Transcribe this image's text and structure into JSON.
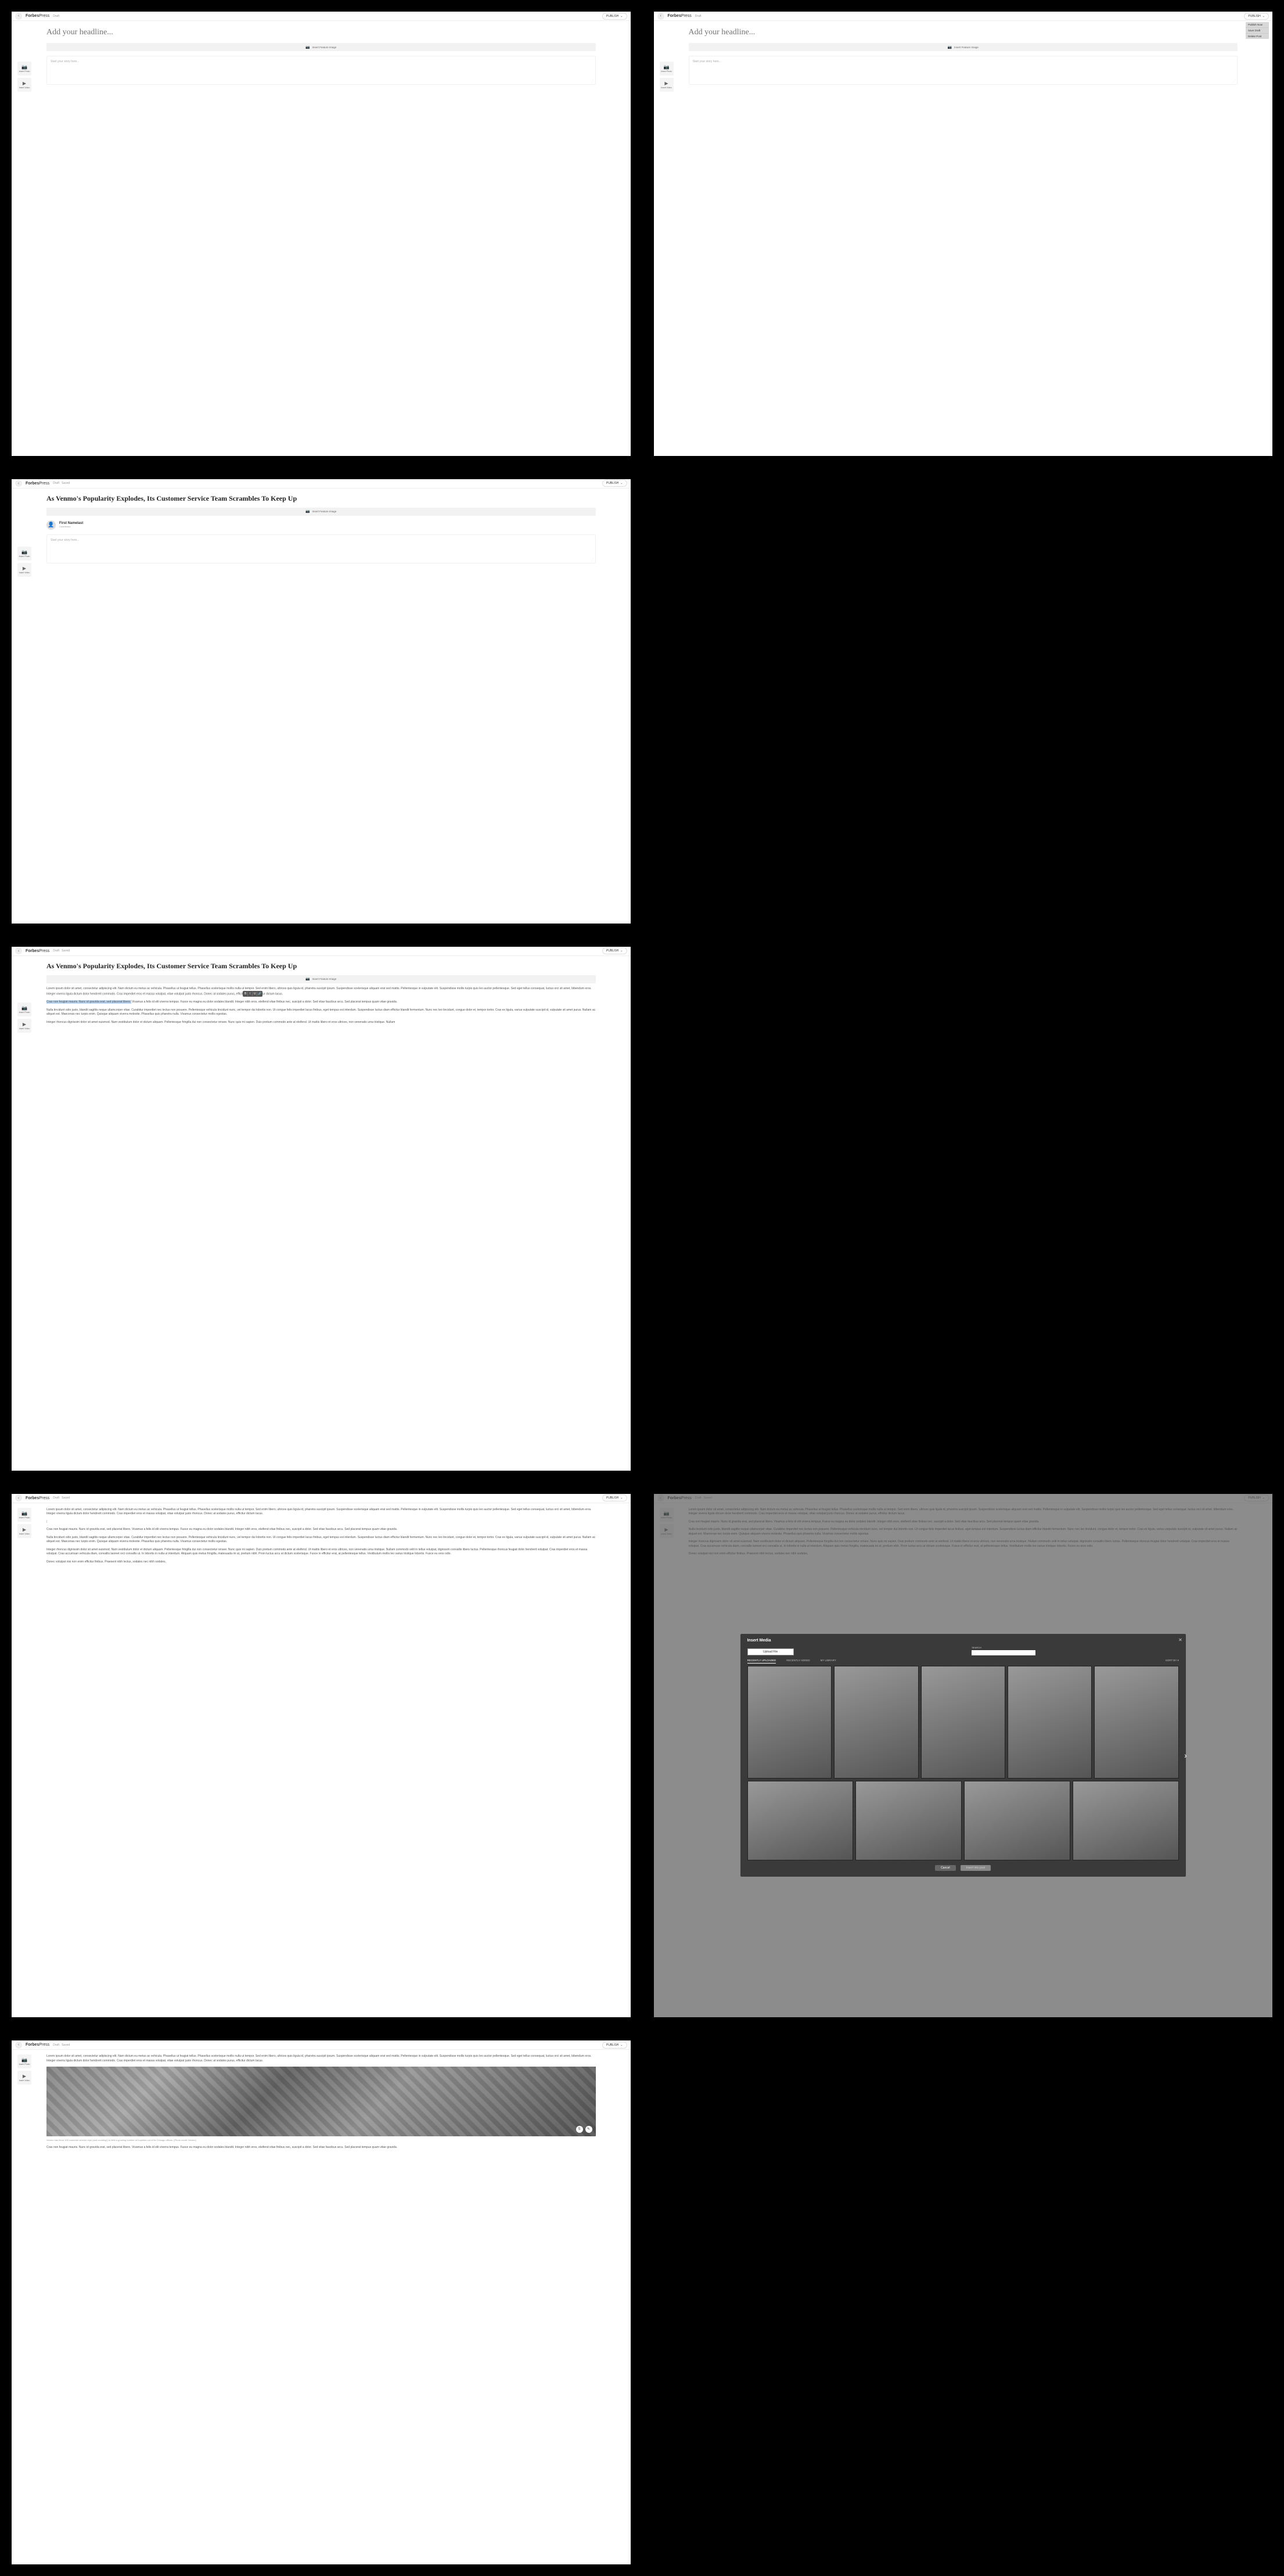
{
  "brand": {
    "bold": "Forbes",
    "thin": "Press"
  },
  "topbar": {
    "draft_label": "Draft",
    "saved_label": "Saved",
    "publish_label": "PUBLISH"
  },
  "dropdown": {
    "publish_now": "Publish Now",
    "save_draft": "Save Draft",
    "delete_post": "Delete Post"
  },
  "editor": {
    "headline_placeholder": "Add your headline...",
    "feature_image_label": "Insert Feature Image",
    "story_placeholder": "Start your story here...",
    "headline_filled": "As Venmo's Popularity Explodes, Its Customer Service Team Scrambles To Keep Up"
  },
  "sidebar": {
    "insert_photo": "Insert Photo",
    "insert_video": "Insert Video"
  },
  "author": {
    "name": "First Namelast",
    "role": "Contributor"
  },
  "inline_tools": {
    "bold": "B",
    "italic": "I",
    "underline": "U",
    "link": "🔗"
  },
  "body": {
    "p1": "Lorem ipsum dolor sit amet, consectetur adipiscing elit. Nam dictum eu metus ac vehicula. Phasellus ut feugiat tellus. Phasellus scelerisque mollis nulla ut tempor. Sed enim libero, ultrices quis ligula id, pharetra suscipit ipsum. Suspendisse scelerisque aliquam erat sed mattis. Pellentesque in vulputate elit. Suspendisse mollis turpis quis leo auctor pellentesque. Sed eget tellus consequat, luctus orci sit amet, bibendum eros. Integer viverra ligula dictum dolor hendrerit commodo. Cras imperdiet eros et massa volutpat, vitae volutpat justo rhoncus. Donec at sodales purus, efficit",
    "p1_tail": "ur dictum lacus.",
    "p2_hl": "Cras non feugiat mauris. Nunc id gravida erat, sed placerat libero.",
    "p2_rest": " Vivamus a felis id elit viverra tempus. Fusce eu magna eu dolor sodales blandit. Integer nibh eros, eleifend vitae finibus nec, suscipit a dolor. Sed vitae faucibus arcu. Sed placerat tempus quam vitae gravida.",
    "p3": "Nulla tincidunt odio justo, blandit sagittis neque ullamcorper vitae. Curabitur imperdiet nec lectus non posuere. Pellentesque vehicula tincidunt nunc, vel tempor dui lobortis non. Ut congue felis imperdiet lacus finibus, eget tempus est interdum. Suspendisse luctus diam efficitur blandit fermentum. Nunc nec leo tincidunt, congue dolor et, tempor tortor. Cras ex ligula, varius vulputate suscipit id, vulputate sit amet purus. Nullam ac aliquet est. Maecenas nec turpis enim. Quisque aliquam viverra molestie. Phasellus quis pharetra nulla. Vivamus consectetur mollis egestas.",
    "p4": "Integer rhoncus dignissim dolor sit amet euismod. Nam vestibulum dolor et dictum aliquam. Pellentesque fringilla dui non consectetur ornare. Nunc quis mi sapien. Duis pretium commodo ante at eleifend. Ut mattis libero et eros ultrices, non venenatis urna tristique. Nullam commodo velit in tellus volutpat, dignissim convallis libero luctus. Pellentesque rhoncus feugiat dolor hendrerit volutpat. Cras imperdiet eros et massa volutpat. Cras accumsan vehicula diam, convallis laoreet orci convallis ut. In lobortis in nulla ut interdum. Aliquam quis metus fringilla, malesuada mi at, pretium nibh. Proin luctus arcu at dictum scelerisque. Fusce in efficitur erat, at pellentesque tellus. Vestibulum mollis leo varius tristique lobortis. Fusce eu eros odio.",
    "p5": "Donec volutpat nisi non enim efficitur finibus. Praesent nibh lectus, sodales nec nibh sodales,",
    "p1_plain": "Lorem ipsum dolor sit amet, consectetur adipiscing elit. Nam dictum eu metus ac vehicula. Phasellus ut feugiat tellus. Phasellus scelerisque mollis nulla ut tempor. Sed enim libero, ultrices quis ligula id, pharetra suscipit ipsum. Suspendisse scelerisque aliquam erat sed mattis. Pellentesque in vulputate elit. Suspendisse mollis turpis quis leo auctor pellentesque. Sed eget tellus consequat, luctus orci sit amet, bibendum eros. Integer viverra ligula dictum dolor hendrerit commodo. Cras imperdiet eros et massa volutpat, vitae volutpat justo rhoncus. Donec at sodales purus, efficitur dictum lacus.",
    "p2_plain": "Cras non feugiat mauris. Nunc id gravida erat, sed placerat libero. Vivamus a felis id elit viverra tempus. Fusce eu magna eu dolor sodales blandit. Integer nibh eros, eleifend vitae finibus nec, suscipit a dolor. Sed vitae faucibus arcu. Sed placerat tempus quam vitae gravida.",
    "p4_short": "Integer rhoncus dignissim dolor sit amet euismod. Nam vestibulum dolor et dictum aliquam. Pellentesque fringilla dui non consectetur ornare. Nunc quis mi sapien. Duis pretium commodo ante at eleifend. Ut mattis libero et eros ultrices, non venenatis urna tristique. Nullam"
  },
  "image": {
    "caption": "Venmo has hired 100 customer service reps (and counting!) to field a growing number of inquiries out of its Chicago offices. (Photo credit: Venmo)",
    "size_btn": "S",
    "edit_btn": "✎"
  },
  "modal": {
    "title": "Insert Media",
    "upload": "Upload File",
    "search_label": "SEARCH",
    "cancel": "Cancel",
    "insert": "Insert into post",
    "tabs": {
      "recent": "RECENTLY UPLOADED",
      "added": "RECENTLY ADDED",
      "library": "MY LIBRARY",
      "sort": "SORT BY ▾"
    }
  }
}
